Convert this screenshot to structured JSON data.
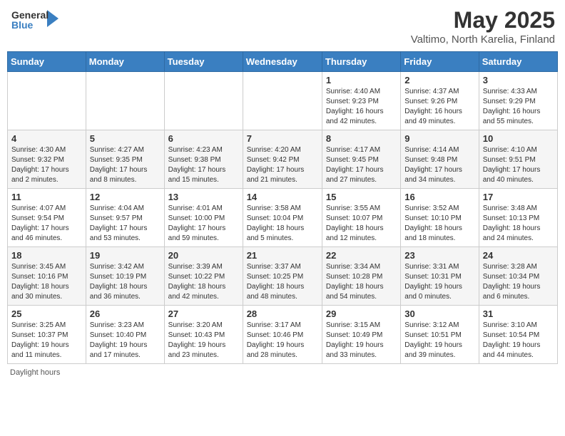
{
  "header": {
    "logo_general": "General",
    "logo_blue": "Blue",
    "month_title": "May 2025",
    "location": "Valtimo, North Karelia, Finland"
  },
  "days_of_week": [
    "Sunday",
    "Monday",
    "Tuesday",
    "Wednesday",
    "Thursday",
    "Friday",
    "Saturday"
  ],
  "weeks": [
    [
      {
        "day": "",
        "info": ""
      },
      {
        "day": "",
        "info": ""
      },
      {
        "day": "",
        "info": ""
      },
      {
        "day": "",
        "info": ""
      },
      {
        "day": "1",
        "info": "Sunrise: 4:40 AM\nSunset: 9:23 PM\nDaylight: 16 hours\nand 42 minutes."
      },
      {
        "day": "2",
        "info": "Sunrise: 4:37 AM\nSunset: 9:26 PM\nDaylight: 16 hours\nand 49 minutes."
      },
      {
        "day": "3",
        "info": "Sunrise: 4:33 AM\nSunset: 9:29 PM\nDaylight: 16 hours\nand 55 minutes."
      }
    ],
    [
      {
        "day": "4",
        "info": "Sunrise: 4:30 AM\nSunset: 9:32 PM\nDaylight: 17 hours\nand 2 minutes."
      },
      {
        "day": "5",
        "info": "Sunrise: 4:27 AM\nSunset: 9:35 PM\nDaylight: 17 hours\nand 8 minutes."
      },
      {
        "day": "6",
        "info": "Sunrise: 4:23 AM\nSunset: 9:38 PM\nDaylight: 17 hours\nand 15 minutes."
      },
      {
        "day": "7",
        "info": "Sunrise: 4:20 AM\nSunset: 9:42 PM\nDaylight: 17 hours\nand 21 minutes."
      },
      {
        "day": "8",
        "info": "Sunrise: 4:17 AM\nSunset: 9:45 PM\nDaylight: 17 hours\nand 27 minutes."
      },
      {
        "day": "9",
        "info": "Sunrise: 4:14 AM\nSunset: 9:48 PM\nDaylight: 17 hours\nand 34 minutes."
      },
      {
        "day": "10",
        "info": "Sunrise: 4:10 AM\nSunset: 9:51 PM\nDaylight: 17 hours\nand 40 minutes."
      }
    ],
    [
      {
        "day": "11",
        "info": "Sunrise: 4:07 AM\nSunset: 9:54 PM\nDaylight: 17 hours\nand 46 minutes."
      },
      {
        "day": "12",
        "info": "Sunrise: 4:04 AM\nSunset: 9:57 PM\nDaylight: 17 hours\nand 53 minutes."
      },
      {
        "day": "13",
        "info": "Sunrise: 4:01 AM\nSunset: 10:00 PM\nDaylight: 17 hours\nand 59 minutes."
      },
      {
        "day": "14",
        "info": "Sunrise: 3:58 AM\nSunset: 10:04 PM\nDaylight: 18 hours\nand 5 minutes."
      },
      {
        "day": "15",
        "info": "Sunrise: 3:55 AM\nSunset: 10:07 PM\nDaylight: 18 hours\nand 12 minutes."
      },
      {
        "day": "16",
        "info": "Sunrise: 3:52 AM\nSunset: 10:10 PM\nDaylight: 18 hours\nand 18 minutes."
      },
      {
        "day": "17",
        "info": "Sunrise: 3:48 AM\nSunset: 10:13 PM\nDaylight: 18 hours\nand 24 minutes."
      }
    ],
    [
      {
        "day": "18",
        "info": "Sunrise: 3:45 AM\nSunset: 10:16 PM\nDaylight: 18 hours\nand 30 minutes."
      },
      {
        "day": "19",
        "info": "Sunrise: 3:42 AM\nSunset: 10:19 PM\nDaylight: 18 hours\nand 36 minutes."
      },
      {
        "day": "20",
        "info": "Sunrise: 3:39 AM\nSunset: 10:22 PM\nDaylight: 18 hours\nand 42 minutes."
      },
      {
        "day": "21",
        "info": "Sunrise: 3:37 AM\nSunset: 10:25 PM\nDaylight: 18 hours\nand 48 minutes."
      },
      {
        "day": "22",
        "info": "Sunrise: 3:34 AM\nSunset: 10:28 PM\nDaylight: 18 hours\nand 54 minutes."
      },
      {
        "day": "23",
        "info": "Sunrise: 3:31 AM\nSunset: 10:31 PM\nDaylight: 19 hours\nand 0 minutes."
      },
      {
        "day": "24",
        "info": "Sunrise: 3:28 AM\nSunset: 10:34 PM\nDaylight: 19 hours\nand 6 minutes."
      }
    ],
    [
      {
        "day": "25",
        "info": "Sunrise: 3:25 AM\nSunset: 10:37 PM\nDaylight: 19 hours\nand 11 minutes."
      },
      {
        "day": "26",
        "info": "Sunrise: 3:23 AM\nSunset: 10:40 PM\nDaylight: 19 hours\nand 17 minutes."
      },
      {
        "day": "27",
        "info": "Sunrise: 3:20 AM\nSunset: 10:43 PM\nDaylight: 19 hours\nand 23 minutes."
      },
      {
        "day": "28",
        "info": "Sunrise: 3:17 AM\nSunset: 10:46 PM\nDaylight: 19 hours\nand 28 minutes."
      },
      {
        "day": "29",
        "info": "Sunrise: 3:15 AM\nSunset: 10:49 PM\nDaylight: 19 hours\nand 33 minutes."
      },
      {
        "day": "30",
        "info": "Sunrise: 3:12 AM\nSunset: 10:51 PM\nDaylight: 19 hours\nand 39 minutes."
      },
      {
        "day": "31",
        "info": "Sunrise: 3:10 AM\nSunset: 10:54 PM\nDaylight: 19 hours\nand 44 minutes."
      }
    ]
  ],
  "footer": {
    "note": "Daylight hours"
  }
}
